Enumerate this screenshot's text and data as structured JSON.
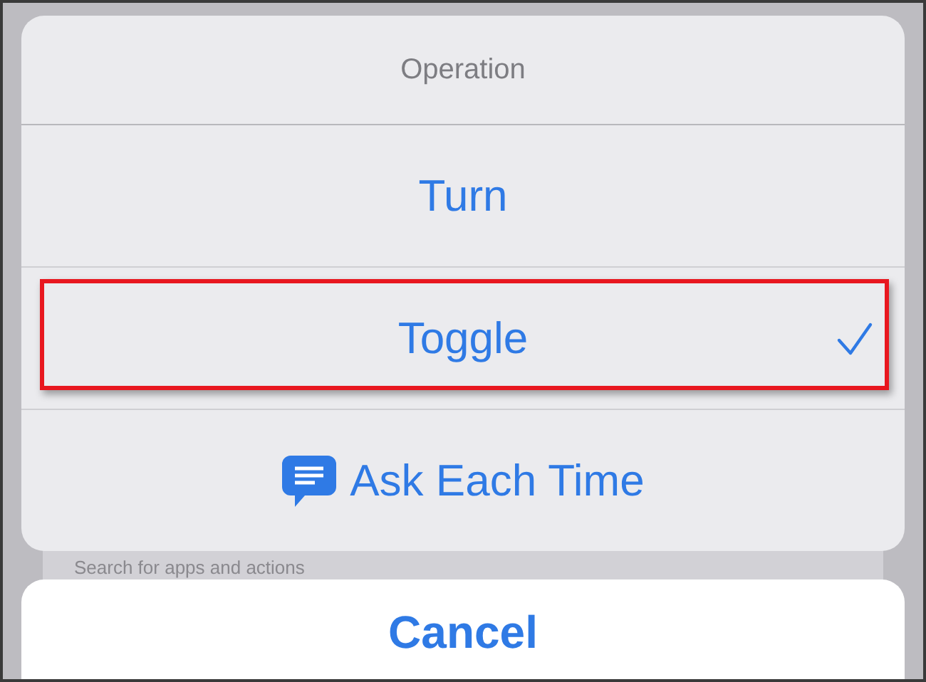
{
  "background": {
    "search": {
      "placeholder": "Search for apps and actions"
    }
  },
  "sheet": {
    "title": "Operation",
    "options": [
      {
        "label": "Turn",
        "kind": "plain",
        "selected": false,
        "highlighted": false
      },
      {
        "label": "Toggle",
        "kind": "plain",
        "selected": true,
        "highlighted": true
      },
      {
        "label": "Ask Each Time",
        "kind": "with-icon",
        "selected": false,
        "highlighted": false
      }
    ]
  },
  "cancel": {
    "label": "Cancel"
  }
}
